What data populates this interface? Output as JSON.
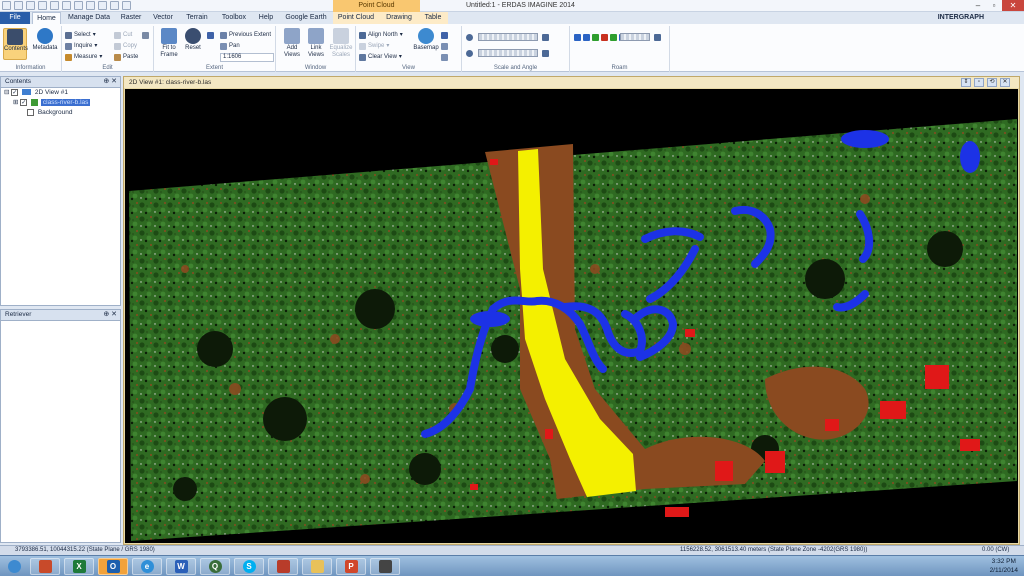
{
  "app": {
    "window_title": "Untitled:1 - ERDAS IMAGINE 2014",
    "context_tab_title": "Point Cloud",
    "brand": "INTERGRAPH"
  },
  "tabs": [
    "File",
    "Home",
    "Manage Data",
    "Raster",
    "Vector",
    "Terrain",
    "Toolbox",
    "Help",
    "Google Earth",
    "Point Cloud",
    "Drawing",
    "Table"
  ],
  "ribbon": {
    "information": {
      "label": "Information",
      "contents": "Contents",
      "metadata": "Metadata"
    },
    "edit": {
      "label": "Edit",
      "select": "Select",
      "inquire": "Inquire",
      "measure": "Measure",
      "cut": "Cut",
      "copy": "Copy",
      "paste": "Paste"
    },
    "extent": {
      "label": "Extent",
      "fit_to_frame": "Fit to Frame",
      "reset": "Reset",
      "previous_extent": "Previous Extent",
      "pan": "Pan",
      "scale": "1:1606"
    },
    "window": {
      "label": "Window",
      "add_views": "Add Views",
      "link_views": "Link Views",
      "equalize_scales": "Equalize Scales"
    },
    "view": {
      "label": "View",
      "align_north": "Align North",
      "swipe": "Swipe",
      "clear_view": "Clear View",
      "basemap": "Basemap"
    },
    "scale_angle": {
      "label": "Scale and Angle"
    },
    "roam": {
      "label": "Roam"
    }
  },
  "contents_panel": {
    "title": "Contents",
    "view_node": "2D View #1",
    "layer_name": "class-river-b.las",
    "background": "Background"
  },
  "retriever_panel": {
    "title": "Retriever"
  },
  "viewer": {
    "title": "2D View #1: class-river-b.las"
  },
  "status": {
    "left_coords": "3793386.51, 10044315.22  (State Plane / GRS 1980)",
    "right_coords": "1156228.52, 3061513.40 meters (State Plane Zone -4202(GRS 1980))",
    "rotation": "0.00 (CW)"
  },
  "taskbar": {
    "time": "3:32 PM",
    "date": "2/11/2014",
    "apps": [
      "erdas-icon",
      "excel-icon",
      "outlook-icon",
      "ie-icon",
      "word-icon",
      "search-icon",
      "skype-icon",
      "erdas-alt-icon",
      "folder-icon",
      "powerpoint-icon",
      "tool-icon"
    ]
  },
  "colors": {
    "vegetation": "#2f6a22",
    "ground": "#8a4a20",
    "road": "#f4f000",
    "water": "#1c32e6",
    "building": "#e01818",
    "unclassified": "#d8d8d8"
  }
}
